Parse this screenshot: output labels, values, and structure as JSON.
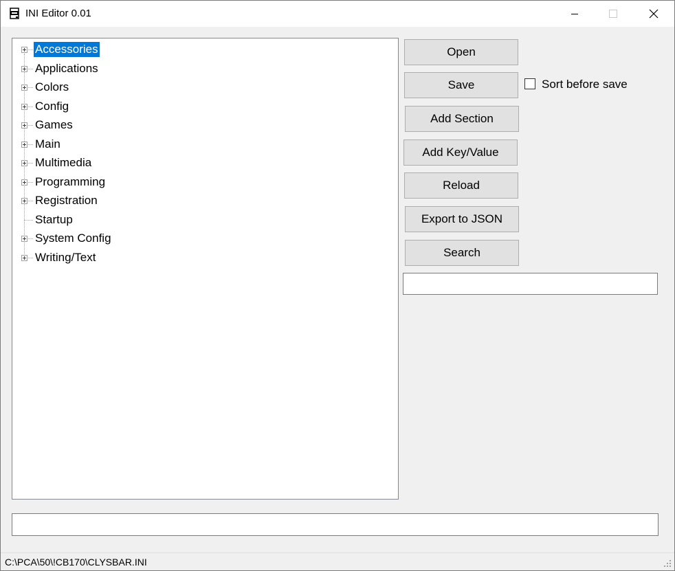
{
  "window": {
    "title": "INI Editor 0.01",
    "icon": "ini-file-icon",
    "controls": [
      "minimize-icon",
      "maximize-icon",
      "close-icon"
    ]
  },
  "tree": {
    "items": [
      {
        "label": "Accessories",
        "expandable": true,
        "selected": true
      },
      {
        "label": "Applications",
        "expandable": true,
        "selected": false
      },
      {
        "label": "Colors",
        "expandable": true,
        "selected": false
      },
      {
        "label": "Config",
        "expandable": true,
        "selected": false
      },
      {
        "label": "Games",
        "expandable": true,
        "selected": false
      },
      {
        "label": "Main",
        "expandable": true,
        "selected": false
      },
      {
        "label": "Multimedia",
        "expandable": true,
        "selected": false
      },
      {
        "label": "Programming",
        "expandable": true,
        "selected": false
      },
      {
        "label": "Registration",
        "expandable": true,
        "selected": false
      },
      {
        "label": "Startup",
        "expandable": false,
        "selected": false
      },
      {
        "label": "System Config",
        "expandable": true,
        "selected": false
      },
      {
        "label": "Writing/Text",
        "expandable": true,
        "selected": false
      }
    ]
  },
  "buttons": {
    "open": "Open",
    "save": "Save",
    "add_section": "Add Section",
    "add_key_value": "Add Key/Value",
    "reload": "Reload",
    "export_json": "Export to JSON",
    "search": "Search"
  },
  "sort_before_save": {
    "label": "Sort before save",
    "checked": false
  },
  "search_input": {
    "value": ""
  },
  "bottom_input": {
    "value": ""
  },
  "status": {
    "path": "C:\\PCA\\50\\!CB170\\CLYSBAR.INI"
  },
  "colors": {
    "selection": "#0078d7",
    "button_face": "#e1e1e1",
    "window_bg": "#f0f0f0"
  }
}
